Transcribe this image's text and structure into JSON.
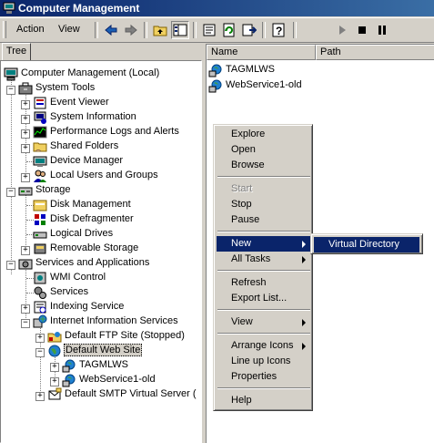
{
  "window": {
    "title": "Computer Management"
  },
  "menubar": {
    "action": "Action",
    "view": "View"
  },
  "toolbar": {
    "icons": [
      "back-icon",
      "forward-icon",
      "up-folder-icon",
      "show-hide-tree-icon",
      "properties-icon",
      "refresh-icon",
      "export-list-icon",
      "help-icon",
      "play-icon",
      "stop-icon",
      "pause-icon"
    ]
  },
  "tree": {
    "tab_label": "Tree",
    "root": "Computer Management (Local)",
    "system_tools": "System Tools",
    "event_viewer": "Event Viewer",
    "system_information": "System Information",
    "perf_logs": "Performance Logs and Alerts",
    "shared_folders": "Shared Folders",
    "device_manager": "Device Manager",
    "local_users": "Local Users and Groups",
    "storage": "Storage",
    "disk_management": "Disk Management",
    "disk_defrag": "Disk Defragmenter",
    "logical_drives": "Logical Drives",
    "removable_storage": "Removable Storage",
    "services_apps": "Services and Applications",
    "wmi_control": "WMI Control",
    "services": "Services",
    "indexing": "Indexing Service",
    "iis": "Internet Information Services",
    "ftp_site": "Default FTP Site (Stopped)",
    "web_site": "Default Web Site",
    "tagmlws": "TAGMLWS",
    "webservice1": "WebService1-old",
    "smtp": "Default SMTP Virtual Server ("
  },
  "list": {
    "columns": [
      "Name",
      "Path"
    ],
    "items": [
      "TAGMLWS",
      "WebService1-old"
    ]
  },
  "context_menu": {
    "explore": "Explore",
    "open": "Open",
    "browse": "Browse",
    "start": "Start",
    "stop": "Stop",
    "pause": "Pause",
    "new": "New",
    "all_tasks": "All Tasks",
    "refresh": "Refresh",
    "export_list": "Export List...",
    "view": "View",
    "arrange_icons": "Arrange Icons",
    "line_up_icons": "Line up Icons",
    "properties": "Properties",
    "help": "Help"
  },
  "submenu": {
    "virtual_directory": "Virtual Directory"
  },
  "colors": {
    "title_start": "#0a246a",
    "title_end": "#3a6ea5",
    "highlight": "#0a246a",
    "face": "#d4d0c8"
  }
}
